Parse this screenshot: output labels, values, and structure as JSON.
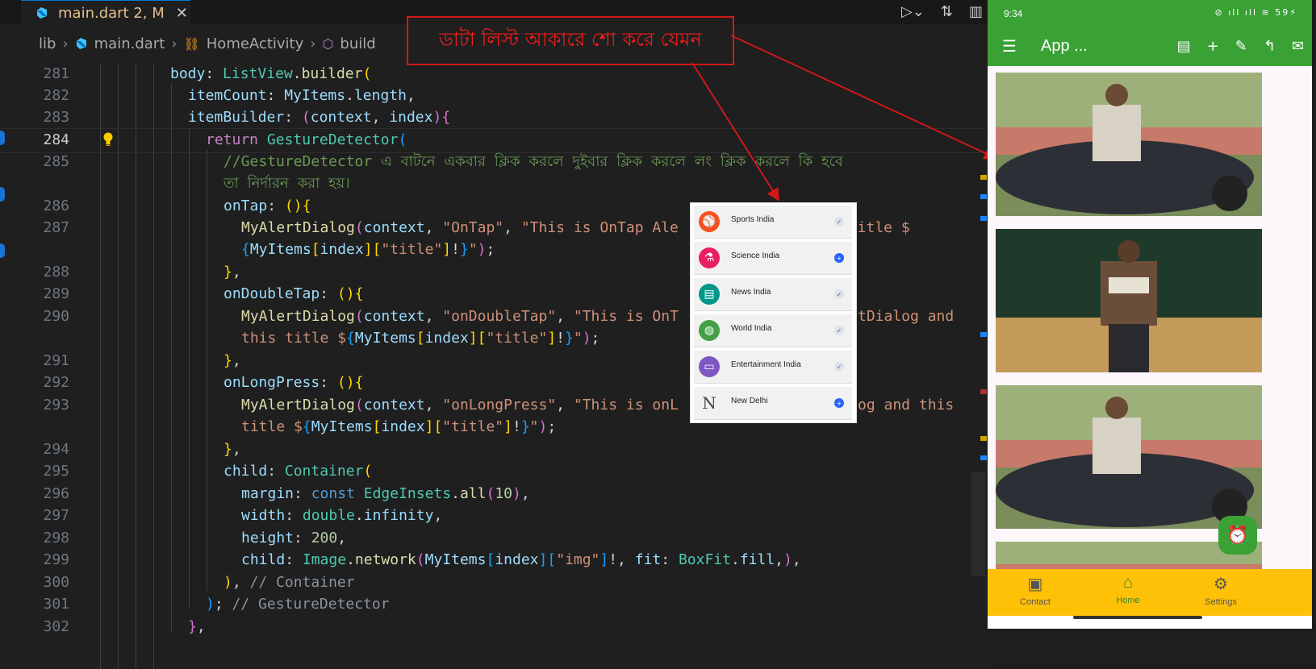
{
  "tab": {
    "file_name": "main.dart",
    "status": "2, M"
  },
  "breadcrumb": {
    "folder": "lib",
    "file": "main.dart",
    "class": "HomeActivity",
    "method": "build"
  },
  "callout": {
    "text": "ডাটা লিস্ট আকারে শো করে যেমন"
  },
  "code": {
    "l281": "281",
    "l282": "282",
    "l283": "283",
    "l284": "284",
    "l285": "285",
    "l286": "286",
    "l287": "287",
    "l288": "288",
    "l289": "289",
    "l290": "290",
    "l291": "291",
    "l292": "292",
    "l293": "293",
    "l294": "294",
    "l295": "295",
    "l296": "296",
    "l297": "297",
    "l298": "298",
    "l299": "299",
    "l300": "300",
    "l301": "301",
    "l302": "302",
    "body": "body",
    "ListView": "ListView",
    "builder": "builder",
    "itemCount": "itemCount",
    "MyItems": "MyItems",
    "length": "length",
    "itemBuilder": "itemBuilder",
    "context": "context",
    "index": "index",
    "return": "return",
    "GestureDetector": "GestureDetector",
    "comment_a": "//GestureDetector এ বাটনে একবার ক্লিক করলে দুইবার ক্লিক করলে লং ক্লিক করলে কি হবে",
    "comment_b": "তা নির্দারন করা হয়।",
    "onTap": "onTap",
    "MyAlertDialog": "MyAlertDialog",
    "s_ontap": "\"OnTap\"",
    "s_ontap_msg": "\"This is OnTap Ale",
    "title_dollar": " title $",
    "s_title": "\"title\"",
    "onDoubleTap": "onDoubleTap",
    "s_ondouble": "\"onDoubleTap\"",
    "s_ondouble_msg": "\"This is OnT",
    "s_ondouble_tail": "tDialog and",
    "s_this_title": "this title $",
    "onLongPress": "onLongPress",
    "s_onlong": "\"onLongPress\"",
    "s_onlong_msg": "\"This is onL",
    "s_onlong_tail": "og and this",
    "s_title2": "title $",
    "child": "child",
    "Container": "Container",
    "margin": "margin",
    "const": "const",
    "EdgeInsets": "EdgeInsets",
    "all": "all",
    "n10": "10",
    "width": "width",
    "double": "double",
    "infinity": "infinity",
    "height": "height",
    "n200": "200",
    "Image": "Image",
    "network": "network",
    "s_img": "\"img\"",
    "fit": "fit",
    "BoxFit": "BoxFit",
    "fill": "fill",
    "c_container": "// Container",
    "c_gesture": "// GestureDetector"
  },
  "popup": {
    "items": [
      {
        "label": "Sports India",
        "color": "#f4511e",
        "state": "checked"
      },
      {
        "label": "Science India",
        "color": "#e91e63",
        "state": "add"
      },
      {
        "label": "News India",
        "color": "#009688",
        "state": "checked"
      },
      {
        "label": "World India",
        "color": "#43a047",
        "state": "checked"
      },
      {
        "label": "Entertainment India",
        "color": "#7e57c2",
        "state": "checked"
      },
      {
        "label": "New Delhi",
        "color": "#9e9e9e",
        "state": "add",
        "letter": "N"
      }
    ]
  },
  "phone": {
    "status_time": "9:34",
    "battery": "59",
    "app_title": "App ...",
    "nav": [
      {
        "label": "Contact",
        "icon": "contact-icon"
      },
      {
        "label": "Home",
        "icon": "home-icon",
        "active": true
      },
      {
        "label": "Settings",
        "icon": "settings-icon"
      }
    ]
  },
  "colors": {
    "appbar": "#3aa135",
    "bottom_nav": "#ffc107",
    "callout_border": "#d01818"
  }
}
